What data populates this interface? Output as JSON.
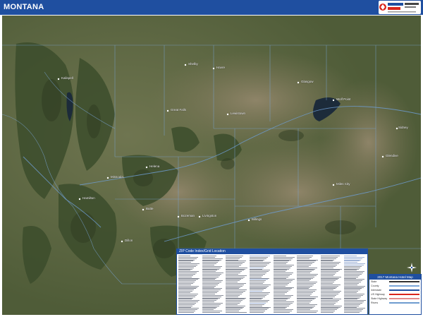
{
  "header": {
    "title": "MONTANA",
    "bar_color": "#1f4fa0"
  },
  "logo": {
    "icon": "market-maps-logo-icon"
  },
  "map": {
    "style": "satellite",
    "state": "Montana",
    "place_labels": [
      "Kalispell",
      "Missoula",
      "Helena",
      "Great Falls",
      "Havre",
      "Glasgow",
      "Bozeman",
      "Billings",
      "Miles City",
      "Butte",
      "Lewistown",
      "Sidney",
      "Glendive",
      "Dillon",
      "Hamilton",
      "Livingston",
      "Wolf Point",
      "Shelby"
    ]
  },
  "index_panel": {
    "title": "ZIP Code Index/Grid Location"
  },
  "legend": {
    "title": "2017 Montana Hotel Map",
    "rows": [
      "State",
      "County",
      "Interstate",
      "US Highway",
      "State Highway",
      "Rivers"
    ]
  },
  "compass": {
    "icon": "north-arrow-icon"
  },
  "colors": {
    "water": "#1c2b3a",
    "lines": "#7aa6d8",
    "forest": "#3c4d2c"
  }
}
